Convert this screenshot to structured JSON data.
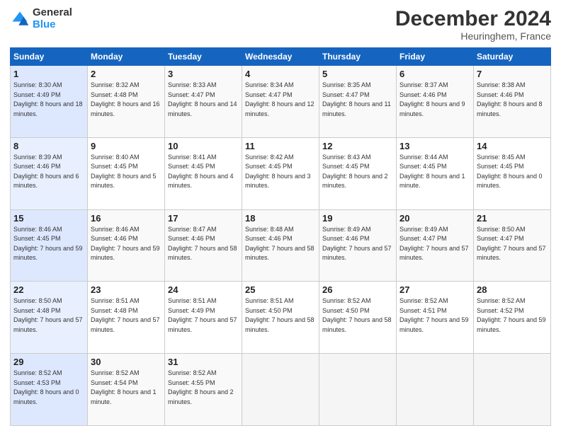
{
  "header": {
    "logo_general": "General",
    "logo_blue": "Blue",
    "title": "December 2024",
    "subtitle": "Heuringhem, France"
  },
  "days_of_week": [
    "Sunday",
    "Monday",
    "Tuesday",
    "Wednesday",
    "Thursday",
    "Friday",
    "Saturday"
  ],
  "weeks": [
    [
      {
        "day": "1",
        "sunrise": "8:30 AM",
        "sunset": "4:49 PM",
        "daylight": "8 hours and 18 minutes."
      },
      {
        "day": "2",
        "sunrise": "8:32 AM",
        "sunset": "4:48 PM",
        "daylight": "8 hours and 16 minutes."
      },
      {
        "day": "3",
        "sunrise": "8:33 AM",
        "sunset": "4:47 PM",
        "daylight": "8 hours and 14 minutes."
      },
      {
        "day": "4",
        "sunrise": "8:34 AM",
        "sunset": "4:47 PM",
        "daylight": "8 hours and 12 minutes."
      },
      {
        "day": "5",
        "sunrise": "8:35 AM",
        "sunset": "4:47 PM",
        "daylight": "8 hours and 11 minutes."
      },
      {
        "day": "6",
        "sunrise": "8:37 AM",
        "sunset": "4:46 PM",
        "daylight": "8 hours and 9 minutes."
      },
      {
        "day": "7",
        "sunrise": "8:38 AM",
        "sunset": "4:46 PM",
        "daylight": "8 hours and 8 minutes."
      }
    ],
    [
      {
        "day": "8",
        "sunrise": "8:39 AM",
        "sunset": "4:46 PM",
        "daylight": "8 hours and 6 minutes."
      },
      {
        "day": "9",
        "sunrise": "8:40 AM",
        "sunset": "4:45 PM",
        "daylight": "8 hours and 5 minutes."
      },
      {
        "day": "10",
        "sunrise": "8:41 AM",
        "sunset": "4:45 PM",
        "daylight": "8 hours and 4 minutes."
      },
      {
        "day": "11",
        "sunrise": "8:42 AM",
        "sunset": "4:45 PM",
        "daylight": "8 hours and 3 minutes."
      },
      {
        "day": "12",
        "sunrise": "8:43 AM",
        "sunset": "4:45 PM",
        "daylight": "8 hours and 2 minutes."
      },
      {
        "day": "13",
        "sunrise": "8:44 AM",
        "sunset": "4:45 PM",
        "daylight": "8 hours and 1 minute."
      },
      {
        "day": "14",
        "sunrise": "8:45 AM",
        "sunset": "4:45 PM",
        "daylight": "8 hours and 0 minutes."
      }
    ],
    [
      {
        "day": "15",
        "sunrise": "8:46 AM",
        "sunset": "4:45 PM",
        "daylight": "7 hours and 59 minutes."
      },
      {
        "day": "16",
        "sunrise": "8:46 AM",
        "sunset": "4:46 PM",
        "daylight": "7 hours and 59 minutes."
      },
      {
        "day": "17",
        "sunrise": "8:47 AM",
        "sunset": "4:46 PM",
        "daylight": "7 hours and 58 minutes."
      },
      {
        "day": "18",
        "sunrise": "8:48 AM",
        "sunset": "4:46 PM",
        "daylight": "7 hours and 58 minutes."
      },
      {
        "day": "19",
        "sunrise": "8:49 AM",
        "sunset": "4:46 PM",
        "daylight": "7 hours and 57 minutes."
      },
      {
        "day": "20",
        "sunrise": "8:49 AM",
        "sunset": "4:47 PM",
        "daylight": "7 hours and 57 minutes."
      },
      {
        "day": "21",
        "sunrise": "8:50 AM",
        "sunset": "4:47 PM",
        "daylight": "7 hours and 57 minutes."
      }
    ],
    [
      {
        "day": "22",
        "sunrise": "8:50 AM",
        "sunset": "4:48 PM",
        "daylight": "7 hours and 57 minutes."
      },
      {
        "day": "23",
        "sunrise": "8:51 AM",
        "sunset": "4:48 PM",
        "daylight": "7 hours and 57 minutes."
      },
      {
        "day": "24",
        "sunrise": "8:51 AM",
        "sunset": "4:49 PM",
        "daylight": "7 hours and 57 minutes."
      },
      {
        "day": "25",
        "sunrise": "8:51 AM",
        "sunset": "4:50 PM",
        "daylight": "7 hours and 58 minutes."
      },
      {
        "day": "26",
        "sunrise": "8:52 AM",
        "sunset": "4:50 PM",
        "daylight": "7 hours and 58 minutes."
      },
      {
        "day": "27",
        "sunrise": "8:52 AM",
        "sunset": "4:51 PM",
        "daylight": "7 hours and 59 minutes."
      },
      {
        "day": "28",
        "sunrise": "8:52 AM",
        "sunset": "4:52 PM",
        "daylight": "7 hours and 59 minutes."
      }
    ],
    [
      {
        "day": "29",
        "sunrise": "8:52 AM",
        "sunset": "4:53 PM",
        "daylight": "8 hours and 0 minutes."
      },
      {
        "day": "30",
        "sunrise": "8:52 AM",
        "sunset": "4:54 PM",
        "daylight": "8 hours and 1 minute."
      },
      {
        "day": "31",
        "sunrise": "8:52 AM",
        "sunset": "4:55 PM",
        "daylight": "8 hours and 2 minutes."
      },
      null,
      null,
      null,
      null
    ]
  ],
  "labels": {
    "sunrise": "Sunrise:",
    "sunset": "Sunset:",
    "daylight": "Daylight:"
  }
}
